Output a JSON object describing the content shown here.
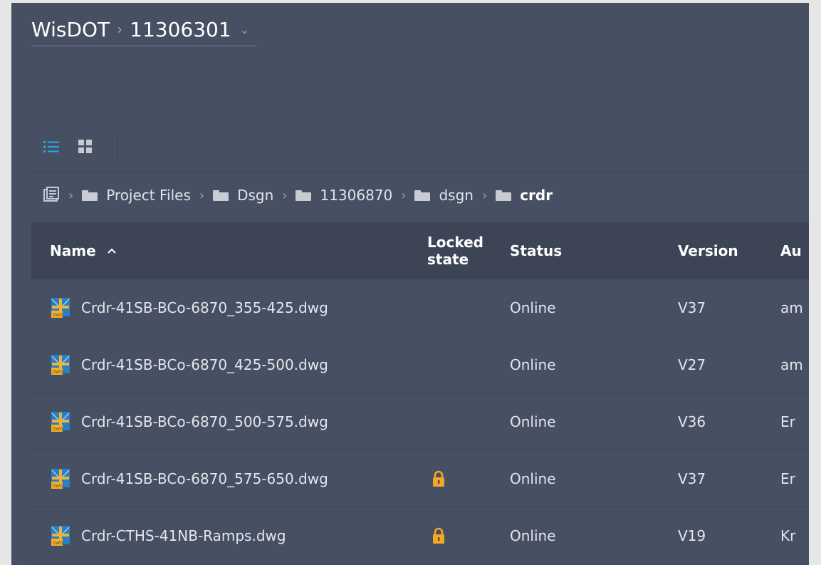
{
  "header": {
    "project": "WisDOT",
    "separator": "›",
    "subproject": "11306301",
    "dropdown_glyph": "⌄"
  },
  "toolbar": {
    "list_view": "list-view-icon",
    "grid_view": "grid-view-icon",
    "accent": "#2aa8e8"
  },
  "folder_breadcrumb": {
    "separator": "›",
    "items": [
      {
        "label": "Project Files"
      },
      {
        "label": "Dsgn"
      },
      {
        "label": "11306870"
      },
      {
        "label": "dsgn"
      },
      {
        "label": "crdr"
      }
    ]
  },
  "table": {
    "columns": {
      "name": "Name",
      "sort": "^",
      "locked": "Locked state",
      "status": "Status",
      "version": "Version",
      "author": "Au"
    },
    "rows": [
      {
        "name": "Crdr-41SB-BCo-6870_355-425.dwg",
        "locked": false,
        "status": "Online",
        "version": "V37",
        "author": "am"
      },
      {
        "name": "Crdr-41SB-BCo-6870_425-500.dwg",
        "locked": false,
        "status": "Online",
        "version": "V27",
        "author": "am"
      },
      {
        "name": "Crdr-41SB-BCo-6870_500-575.dwg",
        "locked": false,
        "status": "Online",
        "version": "V36",
        "author": "Er"
      },
      {
        "name": "Crdr-41SB-BCo-6870_575-650.dwg",
        "locked": true,
        "status": "Online",
        "version": "V37",
        "author": "Er"
      },
      {
        "name": "Crdr-CTHS-41NB-Ramps.dwg",
        "locked": true,
        "status": "Online",
        "version": "V19",
        "author": "Kr"
      }
    ]
  },
  "colors": {
    "background": "#465062",
    "header_row": "#3c4456",
    "lock": "#f5a623",
    "dwg_file": "#f2b233"
  }
}
